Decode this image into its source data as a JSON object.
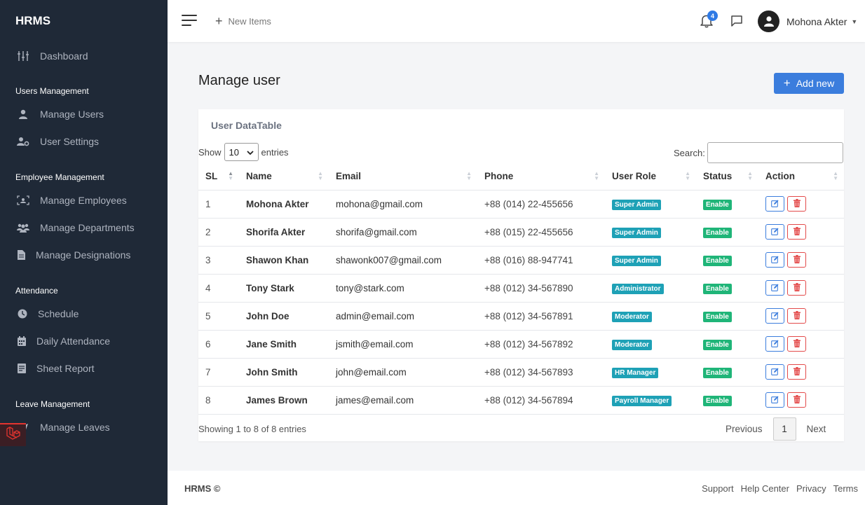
{
  "sidebar": {
    "brand": "HRMS",
    "dashboard": {
      "label": "Dashboard",
      "icon": "sliders-icon"
    },
    "sections": [
      {
        "title": "Users Management",
        "items": [
          {
            "label": "Manage Users",
            "icon": "user-icon"
          },
          {
            "label": "User Settings",
            "icon": "user-gear-icon"
          }
        ]
      },
      {
        "title": "Employee Management",
        "items": [
          {
            "label": "Manage Employees",
            "icon": "id-scan-icon"
          },
          {
            "label": "Manage Departments",
            "icon": "users-group-icon"
          },
          {
            "label": "Manage Designations",
            "icon": "file-icon"
          }
        ]
      },
      {
        "title": "Attendance",
        "items": [
          {
            "label": "Schedule",
            "icon": "clock-icon"
          },
          {
            "label": "Daily Attendance",
            "icon": "calendar-icon"
          },
          {
            "label": "Sheet Report",
            "icon": "report-icon"
          }
        ]
      },
      {
        "title": "Leave Management",
        "items": [
          {
            "label": "Manage Leaves",
            "icon": "plane-icon"
          }
        ]
      }
    ]
  },
  "topbar": {
    "new_items": "New Items",
    "notification_count": "4",
    "user_name": "Mohona Akter"
  },
  "main": {
    "title": "Manage user",
    "add_button": "Add new",
    "card_title": "User DataTable",
    "show_label": "Show",
    "entries_value": "10",
    "entries_label": "entries",
    "search_label": "Search:",
    "columns": [
      "SL",
      "Name",
      "Email",
      "Phone",
      "User Role",
      "Status",
      "Action"
    ],
    "rows": [
      {
        "sl": "1",
        "name": "Mohona Akter",
        "email": "mohona@gmail.com",
        "phone": "+88 (014) 22-455656",
        "role": "Super Admin",
        "status": "Enable"
      },
      {
        "sl": "2",
        "name": "Shorifa Akter",
        "email": "shorifa@gmail.com",
        "phone": "+88 (015) 22-455656",
        "role": "Super Admin",
        "status": "Enable"
      },
      {
        "sl": "3",
        "name": "Shawon Khan",
        "email": "shawonk007@gmail.com",
        "phone": "+88 (016) 88-947741",
        "role": "Super Admin",
        "status": "Enable"
      },
      {
        "sl": "4",
        "name": "Tony Stark",
        "email": "tony@stark.com",
        "phone": "+88 (012) 34-567890",
        "role": "Administrator",
        "status": "Enable"
      },
      {
        "sl": "5",
        "name": "John Doe",
        "email": "admin@email.com",
        "phone": "+88 (012) 34-567891",
        "role": "Moderator",
        "status": "Enable"
      },
      {
        "sl": "6",
        "name": "Jane Smith",
        "email": "jsmith@email.com",
        "phone": "+88 (012) 34-567892",
        "role": "Moderator",
        "status": "Enable"
      },
      {
        "sl": "7",
        "name": "John Smith",
        "email": "john@email.com",
        "phone": "+88 (012) 34-567893",
        "role": "HR Manager",
        "status": "Enable"
      },
      {
        "sl": "8",
        "name": "James Brown",
        "email": "james@email.com",
        "phone": "+88 (012) 34-567894",
        "role": "Payroll Manager",
        "status": "Enable"
      }
    ],
    "showing_text": "Showing 1 to 8 of 8 entries",
    "pagination": {
      "previous": "Previous",
      "current": "1",
      "next": "Next"
    }
  },
  "footer": {
    "brand": "HRMS ©",
    "links": [
      "Support",
      "Help Center",
      "Privacy",
      "Terms"
    ]
  },
  "colors": {
    "sidebar_bg": "#1f2937",
    "primary": "#3b7ddd",
    "role_badge": "#1ea1b6",
    "status_badge": "#1fb578",
    "danger": "#e34a4a"
  }
}
